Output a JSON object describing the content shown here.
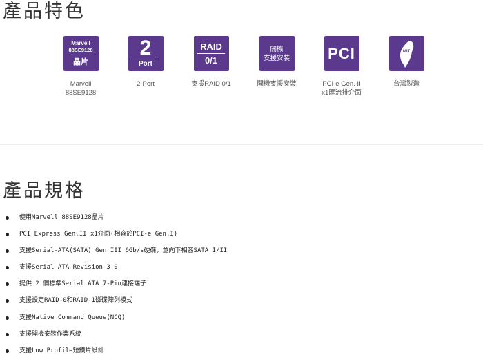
{
  "features": {
    "title": "產品特色",
    "items": [
      {
        "tile": [
          "Marvell",
          "88SE9128",
          "晶片"
        ],
        "caption": "Marvell\n88SE9128"
      },
      {
        "tile": [
          "2",
          "Port"
        ],
        "caption": "2-Port"
      },
      {
        "tile": [
          "RAID",
          "0/1"
        ],
        "caption": "支援RAID 0/1"
      },
      {
        "tile": [
          "開機",
          "支援安裝"
        ],
        "caption": "開機支援安裝"
      },
      {
        "tile": [
          "PCI"
        ],
        "caption": "PCI-e Gen. II\nx1匯流排介面"
      },
      {
        "tile": [
          "MIT"
        ],
        "caption": "台灣製造"
      }
    ],
    "tile_color": "#5b3a8e"
  },
  "specs": {
    "title": "產品規格",
    "items": [
      "使用Marvell 88SE9128晶片",
      "PCI Express Gen.II x1介面(相容於PCI-e Gen.I)",
      "支援Serial-ATA(SATA) Gen III 6Gb/s硬碟，並向下相容SATA I/II",
      "支援Serial ATA Revision 3.0",
      "提供 2 個標準Serial ATA 7-Pin連接端子",
      "支援設定RAID-0和RAID-1磁碟陣列模式",
      "支援Native Command Queue(NCQ)",
      "支援開機安裝作業系統",
      "支援Low Profile短鐵片設計"
    ]
  }
}
